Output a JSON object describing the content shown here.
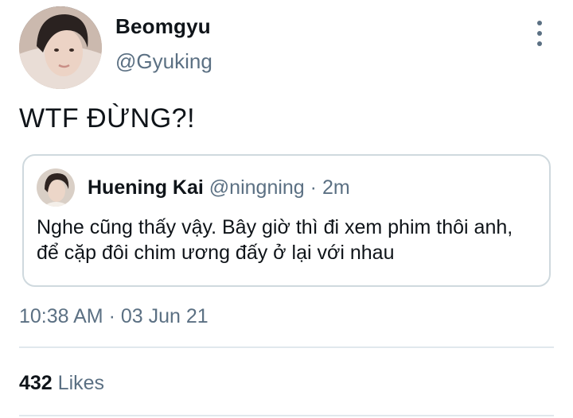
{
  "author": {
    "display_name": "Beomgyu",
    "handle": "@Gyuking"
  },
  "tweet": {
    "text": "WTF ĐỪNG?!",
    "timestamp": "10:38 AM · 03 Jun 21",
    "likes_count": "432",
    "likes_label": "Likes"
  },
  "quote": {
    "display_name": "Huening Kai",
    "handle": "@ningning",
    "separator": " · ",
    "time": "2m",
    "text": "Nghe cũng thấy vậy. Bây giờ thì đi xem phim thôi anh, để cặp đôi chim ương đấy ở lại với nhau"
  },
  "icons": {
    "more": "more-vertical-icon"
  },
  "colors": {
    "text_primary": "#0f1419",
    "text_secondary": "#5b7083",
    "border": "#cfd9de"
  }
}
